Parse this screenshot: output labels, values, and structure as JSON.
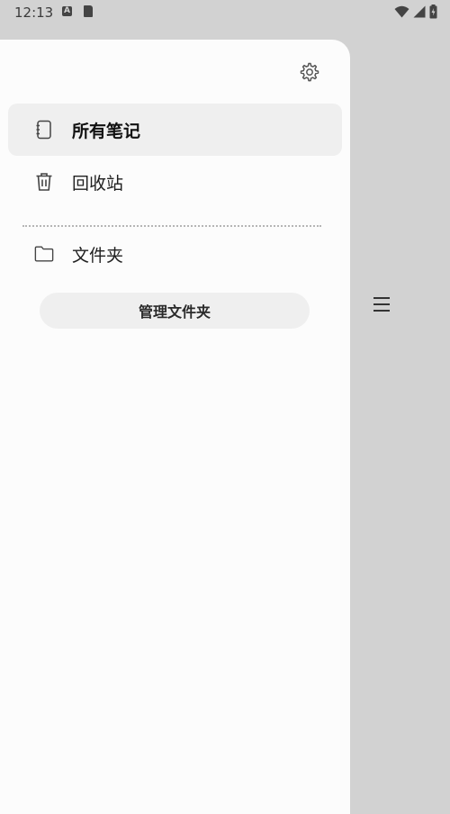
{
  "status_bar": {
    "time": "12:13",
    "icons": [
      "a-notification-icon",
      "sd-card-icon",
      "wifi-icon",
      "signal-icon",
      "battery-icon"
    ]
  },
  "drawer": {
    "settings_icon": "gear-icon",
    "nav_items": [
      {
        "label": "所有笔记",
        "icon": "notebook-icon",
        "active": true
      },
      {
        "label": "回收站",
        "icon": "trash-icon",
        "active": false
      },
      {
        "label": "文件夹",
        "icon": "folder-icon",
        "active": false
      }
    ],
    "manage_folders_label": "管理文件夹"
  },
  "main": {
    "menu_icon": "hamburger-menu-icon"
  },
  "colors": {
    "scrim": "#d2d2d2",
    "drawer_bg": "#fcfcfc",
    "active_bg": "#efefef",
    "text": "#202020"
  }
}
